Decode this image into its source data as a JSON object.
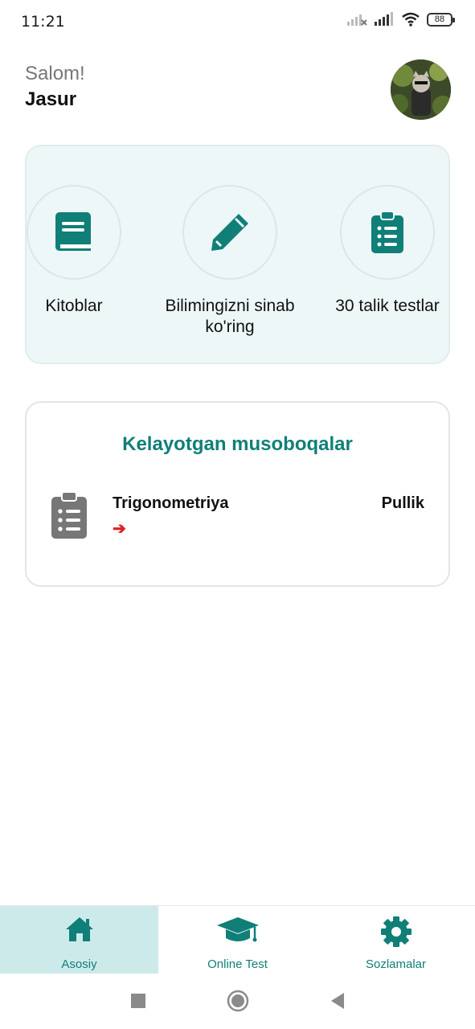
{
  "status_bar": {
    "time": "11:21",
    "battery": "88",
    "icons": [
      "signal-off-icon",
      "signal-icon",
      "wifi-icon",
      "battery-icon"
    ]
  },
  "header": {
    "greeting": "Salom!",
    "name": "Jasur",
    "avatar": "avatar-image"
  },
  "features": [
    {
      "label": "Kitoblar",
      "icon": "book-icon"
    },
    {
      "label": "Bilimingizni sinab ko'ring",
      "icon": "pencil-icon"
    },
    {
      "label": "30 talik testlar",
      "icon": "clipboard-list-icon"
    }
  ],
  "contests": {
    "title": "Kelayotgan musoboqalar",
    "items": [
      {
        "name": "Trigonometriya",
        "price": "Pullik",
        "icon": "clipboard-list-icon",
        "arrow": "➔"
      }
    ]
  },
  "bottom_nav": [
    {
      "label": "Asosiy",
      "icon": "home-icon",
      "active": true
    },
    {
      "label": "Online Test",
      "icon": "graduation-cap-icon",
      "active": false
    },
    {
      "label": "Sozlamalar",
      "icon": "gear-icon",
      "active": false
    }
  ],
  "colors": {
    "accent": "#0f7f78",
    "card_bg": "#eef7f8",
    "nav_active_bg": "#cdeaea",
    "arrow": "#e02020"
  }
}
